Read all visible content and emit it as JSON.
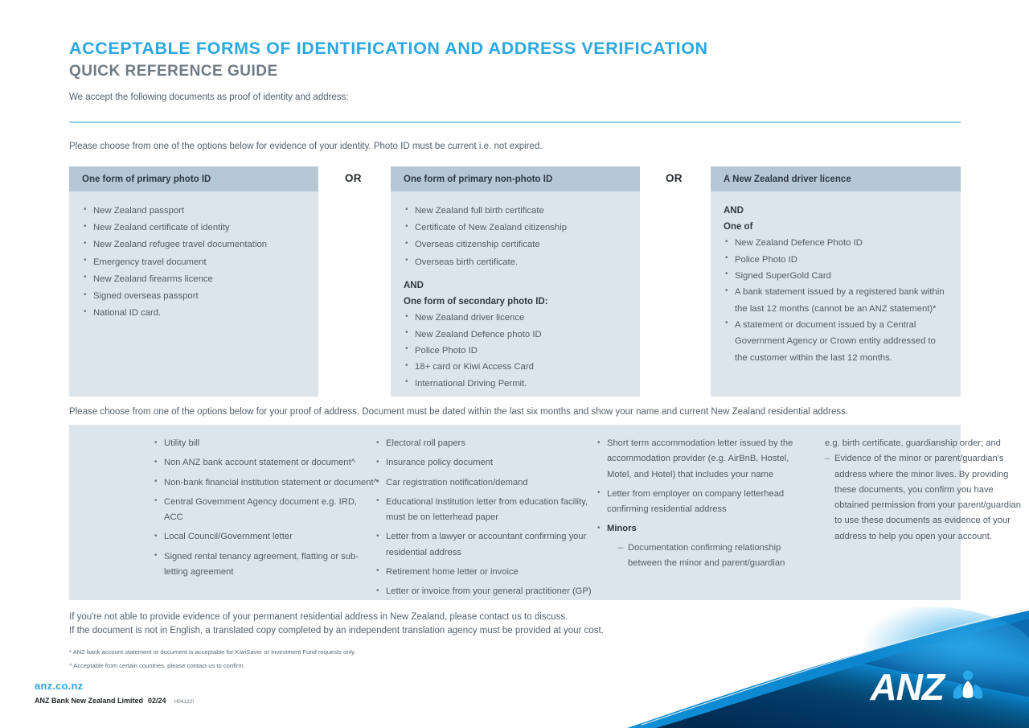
{
  "header": {
    "title": "ACCEPTABLE FORMS OF IDENTIFICATION AND ADDRESS VERIFICATION",
    "subtitle": "QUICK REFERENCE GUIDE",
    "intro": "We accept the following documents as proof of identity and address:",
    "title_color": "#2ba8e0",
    "subtitle_color": "#6e7a85",
    "rule_color": "#8ed2e8"
  },
  "identity": {
    "intro": "Please choose from one of the options below for evidence of your identity. Photo ID must be current i.e. not expired.",
    "or_label_1": "OR",
    "or_label_2": "OR",
    "boxes": [
      {
        "heading": "One form of primary photo ID",
        "items": [
          "New Zealand passport",
          "New Zealand certificate of identity",
          "New Zealand refugee travel documentation",
          "Emergency travel document",
          "New Zealand firearms licence",
          "Signed overseas passport",
          "National ID card."
        ]
      },
      {
        "heading": "One form of primary non-photo ID",
        "items": [
          "New Zealand full birth certificate",
          "Certificate of New Zealand citizenship",
          "Overseas citizenship certificate",
          "Overseas birth certificate."
        ],
        "and_label": "AND",
        "sub_heading": "One form of secondary photo ID:",
        "sub_items": [
          "New Zealand driver licence",
          "New Zealand Defence photo ID",
          "Police Photo ID",
          "18+ card or Kiwi Access Card",
          "International Driving Permit."
        ]
      },
      {
        "heading": "A New Zealand driver licence",
        "and_label": "AND",
        "sub_heading": "One of",
        "sub_items": [
          "New Zealand Defence Photo ID",
          "Police Photo ID",
          "Signed SuperGold Card",
          "A bank statement issued by a registered bank within the last 12 months (cannot be an ANZ statement)*",
          "A statement or document issued by a Central Government Agency or Crown entity addressed to the customer within the last 12 months."
        ]
      }
    ]
  },
  "address": {
    "intro": "Please choose from one of the options below for your proof of address. Document must be dated within the last six months and show your name and current New Zealand residential address.",
    "column1": [
      "Utility bill",
      "Non ANZ bank account statement or document^",
      "Non-bank financial institution statement or document^",
      "Central Government Agency document e.g. IRD, ACC",
      "Local Council/Government letter",
      "Signed rental tenancy agreement, flatting or sub-letting agreement"
    ],
    "column2": [
      "Electoral roll papers",
      "Insurance policy document",
      "Car registration notification/demand",
      "Educational Institution letter from education facility, must be on letterhead paper",
      "Letter from a lawyer or accountant confirming your residential address",
      "Retirement home letter or invoice",
      "Letter or invoice from your general practitioner (GP)"
    ],
    "column3": [
      "Short term accommodation letter issued by the accommodation provider (e.g. AirBnB, Hostel, Motel, and Hotel) that includes your name",
      "Letter from employer on company letterhead confirming residential address"
    ],
    "minors_label": "Minors",
    "minors_items": [
      "Documentation confirming relationship between the minor and parent/guardian"
    ],
    "column4_continuation": "e.g. birth certificate, guardianship order; and",
    "column4_dash_item": "Evidence of the minor or parent/guardian's address where the minor lives. By providing these documents, you confirm you have obtained permission from your parent/guardian to use these documents as evidence of your address to help you open your account."
  },
  "footer": {
    "line1": "If you're not able to provide evidence of your permanent residential address in New Zealand, please contact us to discuss.",
    "line2": "If the document is not in English, a translated copy completed by an independent translation agency must be provided at your cost.",
    "note1": "* ANZ bank account statement or document is acceptable for KiwiSaver or Investment Fund requests only.",
    "note2": "^ Acceptable from certain countries, please contact us to confirm.",
    "website": "anz.co.nz",
    "legal_entity": "ANZ Bank New Zealand Limited",
    "legal_date": "02/24",
    "legal_code": "H04122I",
    "brand_name": "ANZ",
    "brand_color": "#0071b9"
  }
}
